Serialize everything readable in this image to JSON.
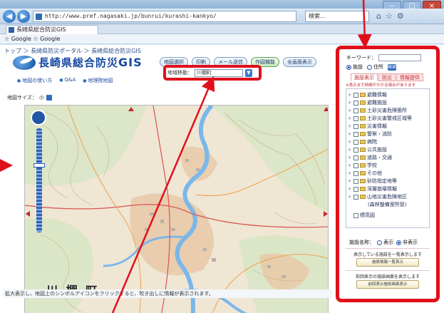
{
  "browser": {
    "address": "http://www.pref.nagasaki.jp/bunrui/kurashi-kankyo/",
    "search_text": "検索...",
    "tab_label": "長崎県総合防災GIS",
    "favorites": "☆ Google ☆ Google",
    "window_buttons": [
      "–",
      "□",
      "×"
    ]
  },
  "page": {
    "breadcrumb": "トップ ＞ 長崎県防災ポータル ＞ 長崎県総合防災GIS",
    "logo_text": "長崎県総合防災",
    "logo_gis": "GIS",
    "toolbar_buttons": [
      "地図選択",
      "印刷",
      "メール送信",
      "作図機能",
      "全画面表示"
    ],
    "zoom_select": "------",
    "links": [
      "地図の使い方",
      "Q&A",
      "地理院地図"
    ],
    "area_label": "地域移動：",
    "area_value": "川棚町",
    "area_drop": "▼",
    "map_size_label": "地図サイズ：",
    "map_size_value": "小",
    "town_label": "川 棚 町",
    "status": "拡大表示し、地図上のシンボルアイコンをクリックすると、吹き出しに情報が表示されます。"
  },
  "panel": {
    "keyword_label": "キーワード：",
    "radio_facility": "施設",
    "radio_place": "住所",
    "radio_ok": "検索",
    "tabs": [
      "施設表示",
      "防災",
      "情報提供"
    ],
    "note": "※表示まで時間がかかる場合があります",
    "items": [
      "避難情報",
      "避難施設",
      "土砂災害危険箇所",
      "土砂災害警戒区域等",
      "災害情報",
      "警察・消防",
      "病院",
      "公共施設",
      "道路・交通",
      "学校",
      "その他",
      "砂防指定地等",
      "深層崩壊情報",
      "山地災害危険地区"
    ],
    "item_sub": "(森林整備室所管)",
    "extra_item": "標高図",
    "facility_name_label": "施設名称：",
    "show": "表示",
    "hide": "非表示",
    "list_caption": "表示している施設を一覧表示します",
    "list_button": "施設情報一覧表示",
    "history_caption": "前回表示の施設画面を表示します",
    "history_button": "前回表示施設画面表示"
  }
}
